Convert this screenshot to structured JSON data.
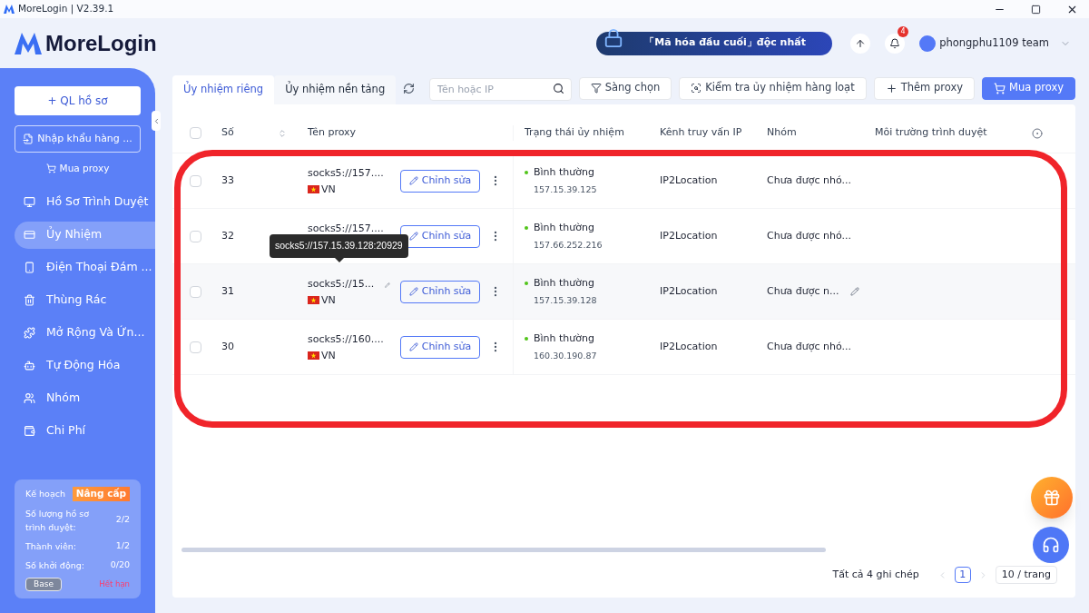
{
  "window": {
    "title": "MoreLogin | V2.39.1"
  },
  "header": {
    "logo": "MoreLogin",
    "promo": "「Mã hóa đầu cuối」độc nhất",
    "notifications": "4",
    "user": "phongphu1109 team"
  },
  "sidebar": {
    "primary_button": "+ QL hồ sơ",
    "import_button": "Nhập khẩu hàng ...",
    "buy_link": "Mua proxy",
    "items": [
      {
        "label": "Hồ Sơ Trình Duyệt",
        "selected": false
      },
      {
        "label": "Ủy Nhiệm",
        "selected": true
      },
      {
        "label": "Điện Thoại Đám ...",
        "selected": false
      },
      {
        "label": "Thùng Rác",
        "selected": false
      },
      {
        "label": "Mở Rộng Và Ứn...",
        "selected": false
      },
      {
        "label": "Tự Động Hóa",
        "selected": false
      },
      {
        "label": "Nhóm",
        "selected": false
      },
      {
        "label": "Chi Phí",
        "selected": false
      }
    ],
    "plan": {
      "label": "Kế hoạch",
      "upgrade": "Nâng cấp",
      "stats": [
        {
          "label": "Số lượng hồ sơ trình duyệt:",
          "value": "2/2"
        },
        {
          "label": "Thành viên:",
          "value": "1/2"
        },
        {
          "label": "Số khởi động:",
          "value": "0/20"
        }
      ],
      "tier": "Base",
      "expiry": "Hết hạn"
    }
  },
  "tabs": [
    {
      "label": "Ủy nhiệm riêng",
      "selected": true
    },
    {
      "label": "Ủy nhiệm nền tảng",
      "selected": false
    }
  ],
  "toolbar": {
    "search": {
      "placeholder": "Tên hoặc IP"
    },
    "buttons": [
      {
        "label": "Sàng chọn",
        "kind": "filter"
      },
      {
        "label": "Kiểm tra ủy nhiệm hàng loạt",
        "kind": "check"
      },
      {
        "label": "Thêm proxy",
        "kind": "add"
      },
      {
        "label": "Mua proxy",
        "kind": "buy"
      }
    ]
  },
  "table": {
    "select_all": {
      "checked": false
    },
    "columns": [
      "Số",
      "Tên proxy",
      "Trạng thái ủy nhiệm",
      "Kênh truy vấn IP",
      "Nhóm",
      "Môi trường trình duyệt"
    ],
    "rows": [
      {
        "number": "33",
        "proxy": "socks5://157....",
        "country": "VN",
        "action": "Chỉnh sửa",
        "status": "Bình thường",
        "ip": "157.15.39.125",
        "channel": "IP2Location",
        "group": "Chưa được nhó...",
        "checked": false,
        "hovered": false
      },
      {
        "number": "32",
        "proxy": "socks5://157....",
        "action": "Chỉnh sửa",
        "status": "Bình thường",
        "ip": "157.66.252.216",
        "channel": "IP2Location",
        "group": "Chưa được nhó...",
        "checked": false,
        "hovered": false
      },
      {
        "number": "31",
        "proxy": "socks5://15...",
        "country": "VN",
        "action": "Chỉnh sửa",
        "status": "Bình thường",
        "ip": "157.15.39.128",
        "channel": "IP2Location",
        "group": "Chưa được n...",
        "checked": false,
        "hovered": true
      },
      {
        "number": "30",
        "proxy": "socks5://160....",
        "country": "VN",
        "action": "Chỉnh sửa",
        "status": "Bình thường",
        "ip": "160.30.190.87",
        "channel": "IP2Location",
        "group": "Chưa được nhó...",
        "checked": false,
        "hovered": false
      }
    ]
  },
  "tooltip": "socks5://157.15.39.128:20929",
  "pagination": {
    "summary": "Tất cả 4 ghi chép",
    "pages": [
      {
        "label": "1",
        "selected": true
      }
    ],
    "page_size": "10 / trang"
  }
}
